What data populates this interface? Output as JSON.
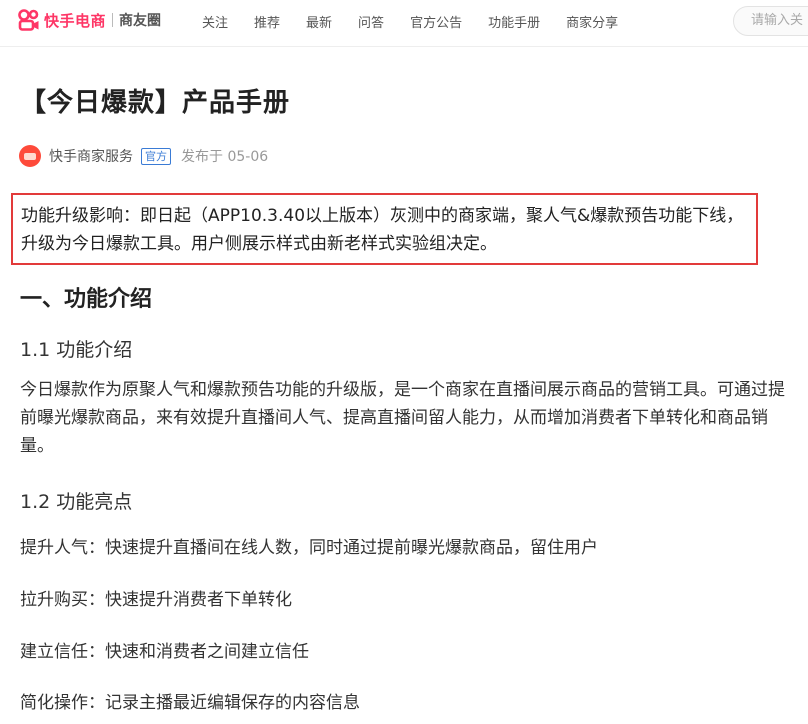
{
  "header": {
    "logo_text": "快手电商",
    "logo_sub": "商友圈",
    "nav": [
      {
        "label": "关注"
      },
      {
        "label": "推荐"
      },
      {
        "label": "最新"
      },
      {
        "label": "问答"
      },
      {
        "label": "官方公告"
      },
      {
        "label": "功能手册"
      },
      {
        "label": "商家分享"
      }
    ],
    "search_placeholder": "请输入关"
  },
  "article": {
    "title": "【今日爆款】产品手册",
    "author": "快手商家服务",
    "official_badge": "官方",
    "publish_date": "发布于 05-06",
    "notice": "功能升级影响：即日起（APP10.3.40以上版本）灰测中的商家端，聚人气&爆款预告功能下线，升级为今日爆款工具。用户侧展示样式由新老样式实验组决定。",
    "section1_title": "一、功能介绍",
    "sub1_title": "1.1 功能介绍",
    "sub1_paragraph": "今日爆款作为原聚人气和爆款预告功能的升级版，是一个商家在直播间展示商品的营销工具。可通过提前曝光爆款商品，来有效提升直播间人气、提高直播间留人能力，从而增加消费者下单转化和商品销量。",
    "sub2_title": "1.2 功能亮点",
    "highlights": [
      "提升人气：快速提升直播间在线人数，同时通过提前曝光爆款商品，留住用户",
      "拉升购买：快速提升消费者下单转化",
      "建立信任：快速和消费者之间建立信任",
      "简化操作：记录主播最近编辑保存的内容信息"
    ]
  },
  "colors": {
    "brand": "#fe3666",
    "notice_border": "#e23a3a",
    "badge": "#3a7bd5"
  },
  "icons": {
    "logo": "kuaishou-logo-icon",
    "avatar": "author-avatar-icon"
  }
}
